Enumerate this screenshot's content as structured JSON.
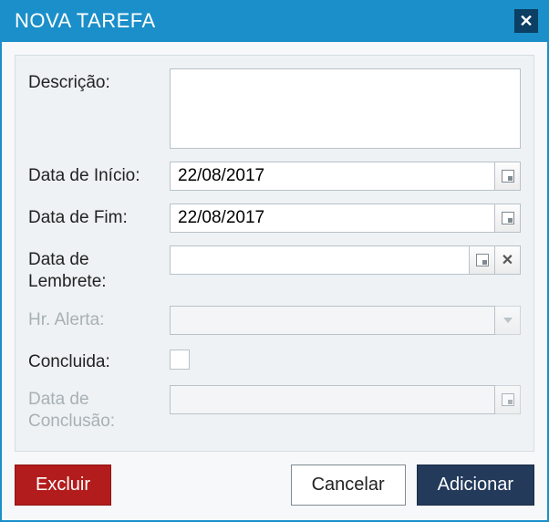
{
  "dialog": {
    "title": "NOVA TAREFA"
  },
  "labels": {
    "descricao": "Descrição:",
    "data_inicio": "Data de Início:",
    "data_fim": "Data de Fim:",
    "data_lembrete": "Data de Lembrete:",
    "hr_alerta": "Hr. Alerta:",
    "concluida": "Concluida:",
    "data_conclusao": "Data de Conclusão:"
  },
  "values": {
    "descricao": "",
    "data_inicio": "22/08/2017",
    "data_fim": "22/08/2017",
    "data_lembrete": "",
    "hr_alerta": "",
    "concluida": false,
    "data_conclusao": ""
  },
  "buttons": {
    "excluir": "Excluir",
    "cancelar": "Cancelar",
    "adicionar": "Adicionar"
  }
}
